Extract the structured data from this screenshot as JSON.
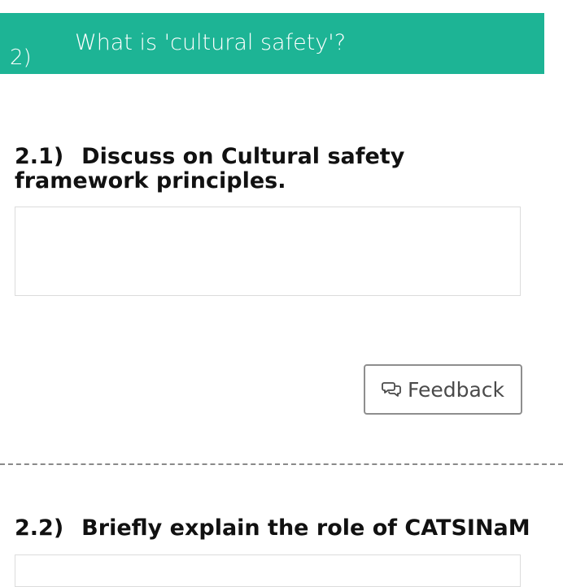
{
  "question": {
    "number": "2)",
    "title": "What is 'cultural safety'?"
  },
  "subquestions": [
    {
      "number": "2.1)",
      "text": "Discuss on Cultural safety framework principles."
    },
    {
      "number": "2.2)",
      "text": "Briefly explain the role of CATSINaM"
    }
  ],
  "feedback_button": {
    "label": "Feedback",
    "icon": "chat-bubbles-icon"
  },
  "colors": {
    "header_bg": "#1db495",
    "header_text": "#ffffff",
    "button_border": "#8e8e8e"
  }
}
